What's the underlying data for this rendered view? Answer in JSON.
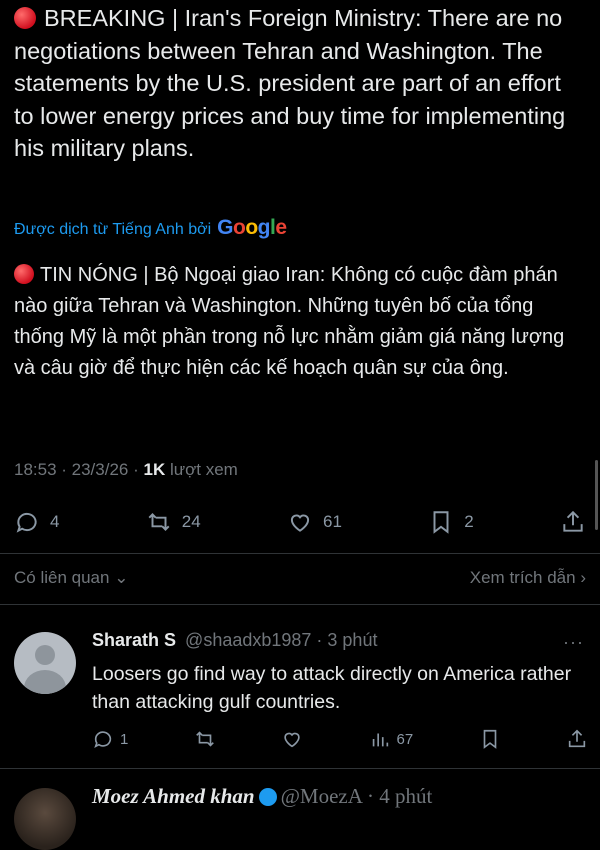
{
  "post": {
    "original_text": "BREAKING | Iran's Foreign Ministry: There are no negotiations between Tehran and Washington. The statements by the U.S. president are part of an effort to lower energy prices and buy time for implementing his military plans.",
    "translated_by_label": "Được dịch từ Tiếng Anh bởi",
    "google_logo": [
      "G",
      "o",
      "o",
      "g",
      "l",
      "e"
    ],
    "translated_text": "TIN NÓNG | Bộ Ngoại giao Iran: Không có cuộc đàm phán nào giữa Tehran và Washington. Những tuyên bố của tổng thống Mỹ là một phần trong nỗ lực nhằm giảm giá năng lượng và câu giờ để thực hiện các kế hoạch quân sự của ông.",
    "timestamp": "18:53 · 23/3/26 ·",
    "views_count": "1K",
    "views_label": "lượt xem",
    "replies": "4",
    "reposts": "24",
    "likes": "61",
    "bookmarks": "2",
    "related_label": "Có liên quan",
    "view_quotes_label": "Xem trích dẫn"
  },
  "reply": {
    "name": "Sharath S",
    "handle_time": "@shaadxb1987 · 3 phút",
    "text": "Loosers go find way to attack directly on America rather than attacking gulf countries.",
    "replies": "1",
    "views": "67",
    "more": "···"
  },
  "next_reply": {
    "name": "Moez Ahmed khan",
    "handle_time": "@MoezA · 4 phút"
  },
  "colors": {
    "background": "#000000",
    "text": "#e7e9ea",
    "muted": "#71767b",
    "link": "#1d9bf0",
    "breaking_dot": "#d10f1f"
  }
}
